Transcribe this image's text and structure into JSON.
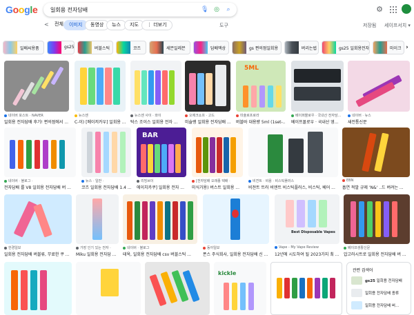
{
  "header": {
    "logo_letters": [
      "G",
      "o",
      "o",
      "g",
      "l",
      "e"
    ],
    "search_query": "일회용 전자담배",
    "search_icons": [
      "microphone-icon",
      "lens-icon",
      "search-icon"
    ],
    "settings_icon": "gear-icon",
    "apps_icon": "apps-grid-icon",
    "avatar_color": "#1e8e3e"
  },
  "tabs": {
    "back_label": "<",
    "items": [
      {
        "label": "전체",
        "active": false
      },
      {
        "label": "이미지",
        "active": true
      },
      {
        "label": "동영상",
        "active": false
      },
      {
        "label": "뉴스",
        "active": false
      },
      {
        "label": "지도",
        "active": false
      },
      {
        "label": "⋮ 더보기",
        "active": false
      }
    ],
    "tools_label": "도구",
    "saved_label": "저장됨",
    "safesearch_label": "세이프서치 ▾"
  },
  "chips": [
    {
      "label": "일배씨용품"
    },
    {
      "label": "gs25"
    },
    {
      "label": "버블스틱"
    },
    {
      "label": "코즈"
    },
    {
      "label": "세븐일레븐"
    },
    {
      "label": "담배액상"
    },
    {
      "label": "gs 편의점일회용"
    },
    {
      "label": "버리는법"
    },
    {
      "label": "gs25 일회용전자"
    },
    {
      "label": "마이크"
    }
  ],
  "cards": [
    {
      "source": "네이버 포스트 · NAVER",
      "title": "일회용 전자담배 후기! 편의점에서 ..."
    },
    {
      "source": "뉴스엔",
      "title": "C-이) [메이저카우] 일회용 ..."
    },
    {
      "source": "뉴스엔 사이 · 와이",
      "title": "탁스 조이스 일회용 전자 ..."
    },
    {
      "source": "오에크쇼프 · 고드",
      "title": "미슐랭 일회용 전자담배 ..."
    },
    {
      "source": "미슐로프로라",
      "title": "버블바 대용량 5ml (1set-..."
    },
    {
      "source": "베이퍼몰로우 · 국내산 전자담...",
      "title": "베이프몰로우 · 국내산 영..."
    },
    {
      "source": "네이버 · 뉴스",
      "title": "새전통신문"
    },
    {
      "source": "네이버 · 블로그 ·",
      "title": "전자담배 를 V8 일회용 전자담배 버 ..."
    },
    {
      "source": "뉴스 · 일반 ·",
      "title": "코즈 일회용 전자담배 1.4 ..."
    },
    {
      "source": "리빙브이",
      "title": "에이치카쿠] 일회용 전자 ..."
    },
    {
      "source": "[전자담배 오래종 택배 ·",
      "title": "미식가용) 버스트 일회용 ..."
    },
    {
      "source": "비젼트 · 비용 · 비스틱플러스",
      "title": "비젼트 트러 비엔트 비스틱플러스, 비스틱, 베어 ..."
    },
    {
      "source": "EBN",
      "title": "흡연 적발 규제 'N&' ..드 버려는 ..."
    },
    {
      "source": "한경일보",
      "title": "일회용 전자담배 버블류, 무료한 쿠 ..."
    },
    {
      "source": "가장 인기 있는 전자 ·",
      "title": "Miku 일회용 전자담 ..."
    },
    {
      "source": "네이버 · 블로그",
      "title": "테옥, 일회용 전자담배 csv 버블스틱 ..."
    },
    {
      "source": "동아일보",
      "title": "폰스 주식회사, 일회용 전자담배 신 ..."
    },
    {
      "source": "Vape - My Vape Review",
      "title": "12년에 시도하여 될 2023가지 최 ..."
    },
    {
      "source": "베이프생활신문",
      "title": "압고러시트로 일회용 전자담배 버 ..."
    }
  ],
  "related": {
    "heading": "관련 검색어",
    "items": [
      {
        "bold": "gs25",
        "rest": " 일회용 전자담배"
      },
      {
        "bold": "",
        "rest": "일회용 전자담배 종류"
      },
      {
        "bold": "",
        "rest": "일회용 전자담배 버..."
      }
    ]
  },
  "colors": {
    "accent": "#0b57d0",
    "active_tab_bg": "#d3e3fd",
    "border": "#dadce0",
    "muted_text": "#5f6368"
  }
}
